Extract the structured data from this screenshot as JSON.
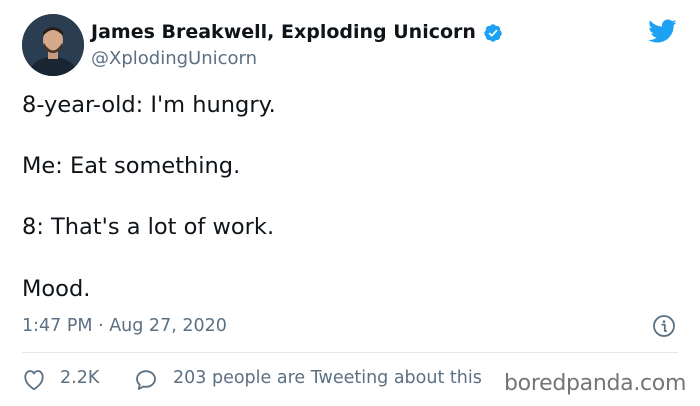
{
  "author": {
    "display_name": "James Breakwell, Exploding Unicorn",
    "handle": "@XplodingUnicorn",
    "verified": true
  },
  "tweet": {
    "lines": [
      "8-year-old: I'm hungry.",
      "Me: Eat something.",
      "8: That's a lot of work.",
      "Mood."
    ],
    "timestamp": "1:47 PM · Aug 27, 2020"
  },
  "actions": {
    "like_count": "2.2K",
    "conversation_text": "203 people are Tweeting about this"
  },
  "watermark": "boredpanda.com",
  "icons": {
    "brand": "twitter-bird-icon",
    "verified": "verified-badge-icon",
    "info": "info-icon",
    "like": "heart-icon",
    "reply": "reply-bubble-icon"
  },
  "colors": {
    "twitter_blue": "#1da1f2",
    "secondary_text": "#5b7083",
    "primary_text": "#0f1419"
  }
}
